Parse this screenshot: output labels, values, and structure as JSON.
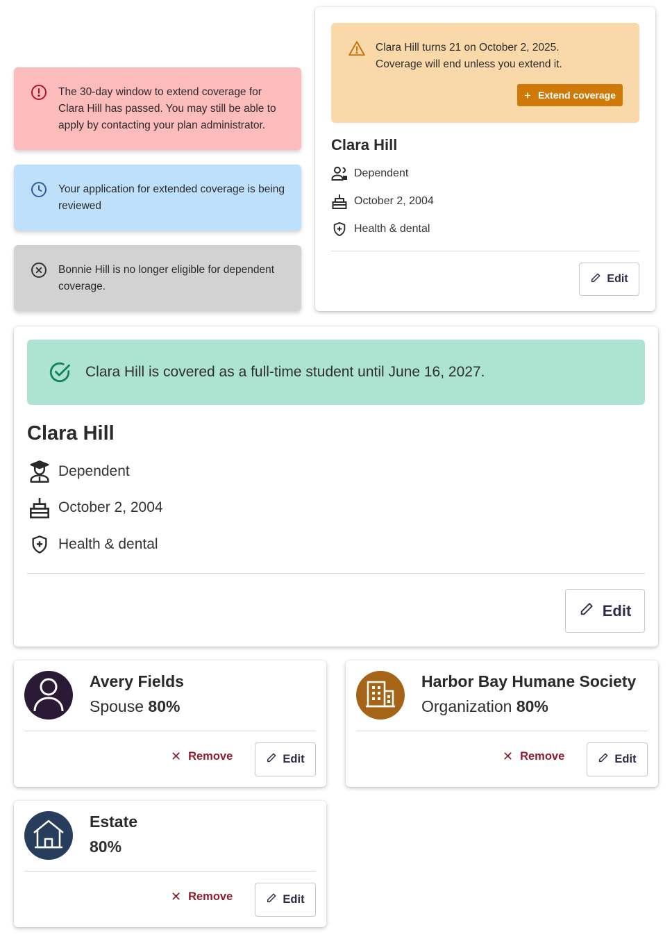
{
  "alerts": {
    "expired": {
      "text": "The 30-day window to extend coverage for Clara Hill has passed. You may still be able to apply by contacting your plan administrator.",
      "icon": "alert-circle-icon",
      "color": "#fbbcbb"
    },
    "reviewing": {
      "text": "Your application for extended coverage is being reviewed",
      "icon": "clock-icon",
      "color": "#bfe0fb"
    },
    "ineligible": {
      "text": "Bonnie Hill is no longer eligible for dependent coverage.",
      "icon": "x-circle-icon",
      "color": "#d2d2d2"
    }
  },
  "dependent_card_small": {
    "warning": {
      "line1": "Clara Hill turns 21 on October 2, 2025.",
      "line2": "Coverage will end unless you extend it.",
      "button": "Extend coverage",
      "icon": "warning-triangle-icon",
      "color": "#f9d9aa",
      "button_color": "#cd7a09"
    },
    "name": "Clara Hill",
    "relationship": "Dependent",
    "birthdate": "October 2, 2004",
    "coverage": "Health & dental",
    "edit_label": "Edit"
  },
  "dependent_card_large": {
    "status": {
      "text": "Clara Hill is covered as a full-time student until June 16, 2027.",
      "icon": "check-circle-icon",
      "color": "#ace4d1"
    },
    "name": "Clara Hill",
    "relationship": "Dependent",
    "birthdate": "October 2, 2004",
    "coverage": "Health & dental",
    "edit_label": "Edit"
  },
  "beneficiaries": [
    {
      "name": "Avery Fields",
      "type": "Spouse",
      "percent": "80%",
      "icon": "person-icon",
      "avatar_color": "#2b1a36",
      "remove_label": "Remove",
      "edit_label": "Edit"
    },
    {
      "name": "Harbor Bay Humane Society",
      "type": "Organization",
      "percent": "80%",
      "icon": "building-icon",
      "avatar_color": "#a66417",
      "remove_label": "Remove",
      "edit_label": "Edit"
    },
    {
      "name": "Estate",
      "type": "",
      "percent": "80%",
      "icon": "house-icon",
      "avatar_color": "#283d5c",
      "remove_label": "Remove",
      "edit_label": "Edit"
    }
  ]
}
